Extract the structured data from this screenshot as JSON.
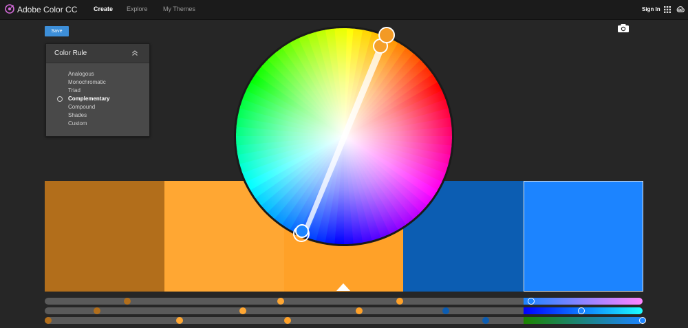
{
  "app": {
    "title": "Adobe Color CC",
    "nav": [
      {
        "label": "Create",
        "active": true
      },
      {
        "label": "Explore",
        "active": false
      },
      {
        "label": "My Themes",
        "active": false
      }
    ],
    "sign_in": "Sign In",
    "icons": [
      "adobe-color-logo-icon",
      "apps-grid-icon",
      "creative-cloud-icon"
    ]
  },
  "toolbar": {
    "save_label": "Save",
    "camera_icon": "camera-icon"
  },
  "color_rule": {
    "title": "Color Rule",
    "selected": "Complementary",
    "options": [
      "Analogous",
      "Monochromatic",
      "Triad",
      "Complementary",
      "Compound",
      "Shades",
      "Custom"
    ]
  },
  "theme": {
    "swatches": [
      "#B26E1B",
      "#FFA733",
      "#FFA128",
      "#0C5DB2",
      "#1C84FF"
    ],
    "base_index": 2,
    "selected_index": 4
  },
  "colors": {
    "accent": "#3D8FD9",
    "background": "#262626",
    "topbar": "#1B1B1B"
  },
  "sliders": {
    "mode": "RGB",
    "knobs": [
      [
        0.138,
        0.395,
        0.594,
        0.814
      ],
      [
        0.088,
        0.331,
        0.526,
        0.671,
        0.898
      ],
      [
        0.006,
        0.226,
        0.406,
        0.738,
        1.0
      ]
    ],
    "swatch_knob_colors": [
      "#B26E1B",
      "#FFA733",
      "#FFA128",
      "#0C5DB2",
      "#1C84FF"
    ],
    "selected_gradients": [
      "linear-gradient(90deg,#1c84ff,#ff84ff)",
      "linear-gradient(90deg,#0000ff,#1cffff)",
      "linear-gradient(90deg,#1c8400,#1c84ff)"
    ]
  }
}
